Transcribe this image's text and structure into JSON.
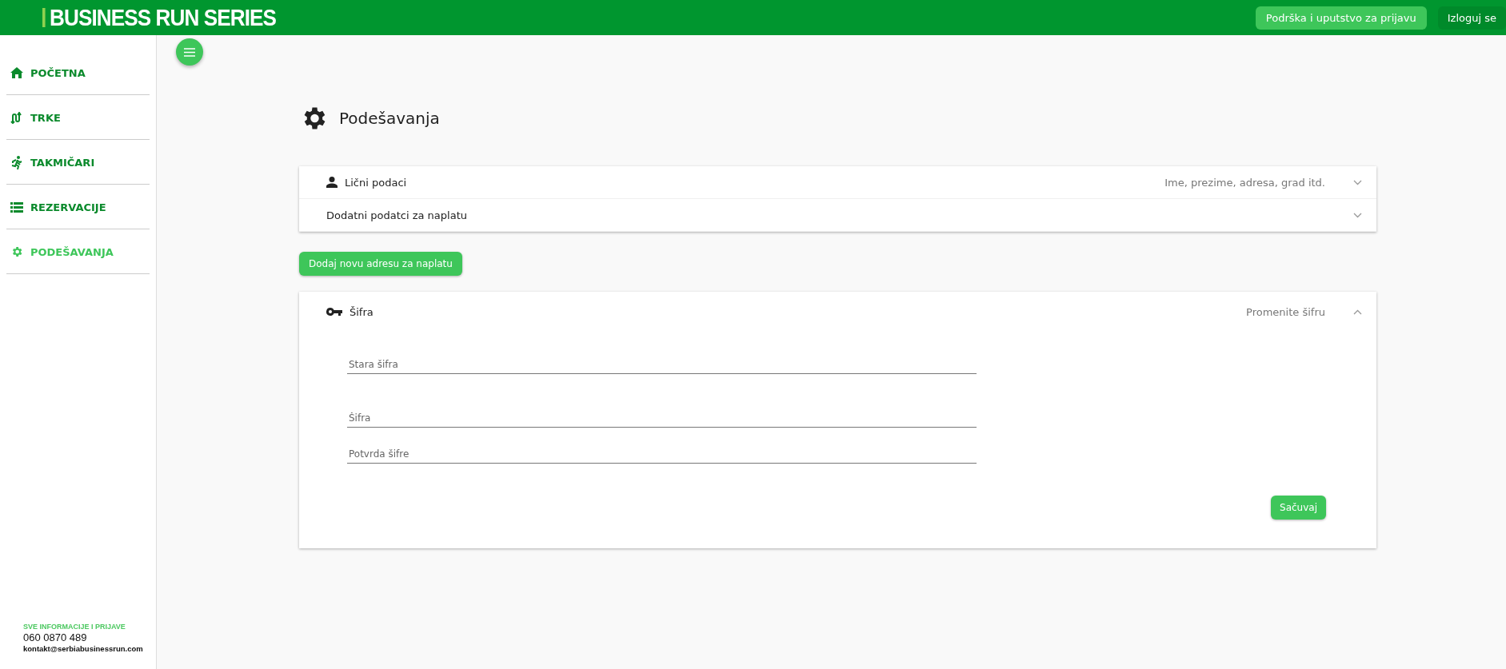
{
  "header": {
    "logo": "BUSINESS RUN SERIES",
    "support_button": "Podrška i uputstvo za prijavu",
    "logout_button": "Izloguj se"
  },
  "sidebar": {
    "items": [
      {
        "label": "POČETNA",
        "kind": "home",
        "selected": false
      },
      {
        "label": "TRKE",
        "kind": "route",
        "selected": false
      },
      {
        "label": "TAKMIČARI",
        "kind": "runner",
        "selected": false
      },
      {
        "label": "REZERVACIJE",
        "kind": "list",
        "selected": false
      },
      {
        "label": "PODEŠAVANJA",
        "kind": "gear",
        "selected": true
      }
    ],
    "footer": {
      "heading": "SVE INFORMACIJE I PRIJAVE",
      "phone": "060 0870 489",
      "email": "kontakt@serbiabusinessrun.com"
    }
  },
  "page": {
    "title": "Podešavanja",
    "billing_panels": [
      {
        "title": "Lični podaci",
        "kind": "person",
        "summary": "Ime, prezime, adresa, grad itd.",
        "expanded": false
      },
      {
        "title": "Dodatni podatci za naplatu",
        "kind": "plain",
        "expanded": false
      }
    ],
    "add_button": "Dodaj novu adresu za naplatu",
    "password_panel": {
      "title": "Šifra",
      "kind": "key",
      "summary": "Promenite šifru",
      "expanded": true,
      "fields": [
        {
          "placeholder": "Stara šifra"
        },
        {
          "placeholder": "Šifra"
        },
        {
          "placeholder": "Potvrda šifre"
        }
      ],
      "save_button": "Sačuvaj"
    }
  }
}
